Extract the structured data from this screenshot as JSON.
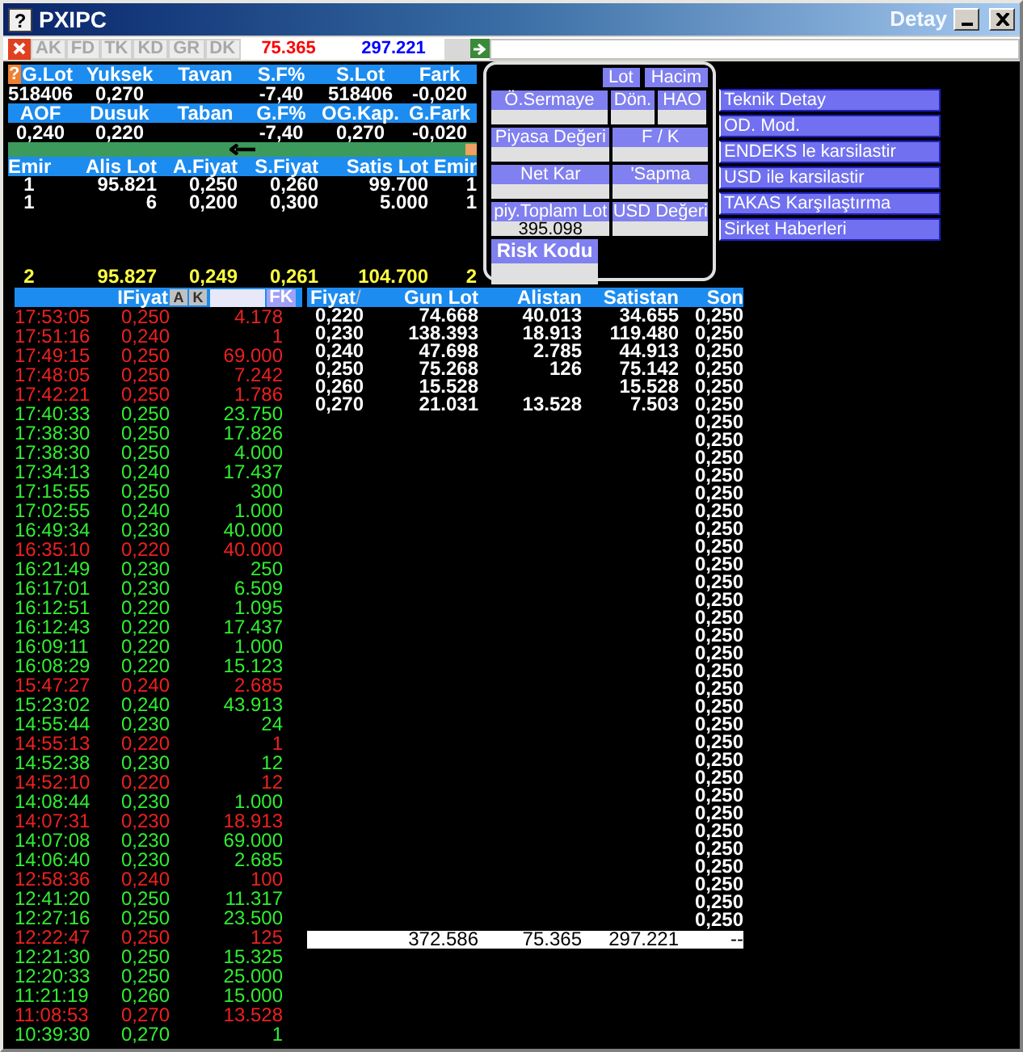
{
  "window": {
    "icon": "?",
    "title": "PXIPC",
    "caption": "Detay"
  },
  "toolbar": {
    "buttons": [
      "AK",
      "FD",
      "TK",
      "KD",
      "GR",
      "DK"
    ],
    "values": [
      {
        "text": "75.365",
        "color": "#ff0000"
      },
      {
        "text": "297.221",
        "color": "#0000ff"
      }
    ]
  },
  "summary": {
    "help": "?",
    "rows": [
      [
        {
          "header": "G.Lot",
          "value": "518406"
        },
        {
          "header": "Yuksek",
          "value": "0,270"
        },
        {
          "header": "Tavan"
        },
        {
          "header": "S.F%",
          "value": "-7,40"
        },
        {
          "header": "S.Lot",
          "value": "518406"
        },
        {
          "header": "Fark",
          "value": "-0,020"
        }
      ],
      [
        {
          "header": "AOF",
          "value": "0,240"
        },
        {
          "header": "Dusuk",
          "value": "0,220"
        },
        {
          "header": "Taban"
        },
        {
          "header": "G.F%",
          "value": "-7,40"
        },
        {
          "header": "OG.Kap.",
          "value": "0,270"
        },
        {
          "header": "G.Fark",
          "value": "-0,020"
        }
      ]
    ]
  },
  "order_book": {
    "columns": [
      "Emir",
      "Alis Lot",
      "A.Fiyat",
      "S.Fiyat",
      "Satis Lot",
      "Emir"
    ],
    "rows": [
      [
        "1",
        "95.821",
        "0,250",
        "0,260",
        "99.700",
        "1"
      ],
      [
        "1",
        "6",
        "0,200",
        "0,300",
        "5.000",
        "1"
      ]
    ],
    "totals": [
      "2",
      "95.827",
      "0,249",
      "0,261",
      "104.700",
      "2"
    ]
  },
  "detail_panel": {
    "buttons": [
      "Lot",
      "Hacim"
    ],
    "rows": [
      [
        {
          "label": "Ö.Sermaye"
        },
        {
          "label": "Dön."
        },
        {
          "label": "HAO"
        }
      ],
      [
        {
          "label": "Piyasa Değeri"
        },
        {
          "label": "F / K"
        }
      ],
      [
        {
          "label": "Net Kar"
        },
        {
          "label": "'Sapma"
        }
      ],
      [
        {
          "label": "piy.Toplam Lot",
          "value": "395.098"
        },
        {
          "label": "USD Değeri"
        }
      ],
      [
        {
          "label": "Risk Kodu"
        }
      ]
    ]
  },
  "menu": [
    "Teknik Detay",
    "OD. Mod.",
    "ENDEKS le karsilastir",
    "USD ile karsilastir",
    "TAKAS Karşılaştırma",
    "Sirket Haberleri"
  ],
  "trades": {
    "header": "IFiyat",
    "filters": [
      "A",
      "K"
    ],
    "fk": "FK",
    "rows": [
      {
        "time": "17:53:05",
        "price": "0,250",
        "lot": "4.178",
        "kind": "down"
      },
      {
        "time": "17:51:16",
        "price": "0,240",
        "lot": "1",
        "kind": "down"
      },
      {
        "time": "17:49:15",
        "price": "0,250",
        "lot": "69.000",
        "kind": "down"
      },
      {
        "time": "17:48:05",
        "price": "0,250",
        "lot": "7.242",
        "kind": "down"
      },
      {
        "time": "17:42:21",
        "price": "0,250",
        "lot": "1.786",
        "kind": "down"
      },
      {
        "time": "17:40:33",
        "price": "0,250",
        "lot": "23.750",
        "kind": "up"
      },
      {
        "time": "17:38:30",
        "price": "0,250",
        "lot": "17.826",
        "kind": "up"
      },
      {
        "time": "17:38:30",
        "price": "0,250",
        "lot": "4.000",
        "kind": "up"
      },
      {
        "time": "17:34:13",
        "price": "0,240",
        "lot": "17.437",
        "kind": "up"
      },
      {
        "time": "17:15:55",
        "price": "0,250",
        "lot": "300",
        "kind": "up"
      },
      {
        "time": "17:02:55",
        "price": "0,240",
        "lot": "1.000",
        "kind": "up"
      },
      {
        "time": "16:49:34",
        "price": "0,230",
        "lot": "40.000",
        "kind": "up"
      },
      {
        "time": "16:35:10",
        "price": "0,220",
        "lot": "40.000",
        "kind": "down"
      },
      {
        "time": "16:21:49",
        "price": "0,230",
        "lot": "250",
        "kind": "up"
      },
      {
        "time": "16:17:01",
        "price": "0,230",
        "lot": "6.509",
        "kind": "up"
      },
      {
        "time": "16:12:51",
        "price": "0,220",
        "lot": "1.095",
        "kind": "up"
      },
      {
        "time": "16:12:43",
        "price": "0,220",
        "lot": "17.437",
        "kind": "up"
      },
      {
        "time": "16:09:11",
        "price": "0,220",
        "lot": "1.000",
        "kind": "up"
      },
      {
        "time": "16:08:29",
        "price": "0,220",
        "lot": "15.123",
        "kind": "up"
      },
      {
        "time": "15:47:27",
        "price": "0,240",
        "lot": "2.685",
        "kind": "down"
      },
      {
        "time": "15:23:02",
        "price": "0,240",
        "lot": "43.913",
        "kind": "up"
      },
      {
        "time": "14:55:44",
        "price": "0,230",
        "lot": "24",
        "kind": "up"
      },
      {
        "time": "14:55:13",
        "price": "0,220",
        "lot": "1",
        "kind": "down"
      },
      {
        "time": "14:52:38",
        "price": "0,230",
        "lot": "12",
        "kind": "up"
      },
      {
        "time": "14:52:10",
        "price": "0,220",
        "lot": "12",
        "kind": "down"
      },
      {
        "time": "14:08:44",
        "price": "0,230",
        "lot": "1.000",
        "kind": "up"
      },
      {
        "time": "14:07:31",
        "price": "0,230",
        "lot": "18.913",
        "kind": "down"
      },
      {
        "time": "14:07:08",
        "price": "0,230",
        "lot": "69.000",
        "kind": "up"
      },
      {
        "time": "14:06:40",
        "price": "0,230",
        "lot": "2.685",
        "kind": "up"
      },
      {
        "time": "12:58:36",
        "price": "0,240",
        "lot": "100",
        "kind": "down"
      },
      {
        "time": "12:41:20",
        "price": "0,250",
        "lot": "11.317",
        "kind": "up"
      },
      {
        "time": "12:27:16",
        "price": "0,250",
        "lot": "23.500",
        "kind": "up"
      },
      {
        "time": "12:22:47",
        "price": "0,250",
        "lot": "125",
        "kind": "down"
      },
      {
        "time": "12:21:30",
        "price": "0,250",
        "lot": "15.325",
        "kind": "up"
      },
      {
        "time": "12:20:33",
        "price": "0,250",
        "lot": "25.000",
        "kind": "up"
      },
      {
        "time": "11:21:19",
        "price": "0,260",
        "lot": "15.000",
        "kind": "up"
      },
      {
        "time": "11:08:53",
        "price": "0,270",
        "lot": "13.528",
        "kind": "down"
      },
      {
        "time": "10:39:30",
        "price": "0,270",
        "lot": "1",
        "kind": "up"
      }
    ]
  },
  "price_table": {
    "columns": [
      "Fiyat",
      "Gun Lot",
      "Alistan",
      "Satistan",
      "Son"
    ],
    "sort_mark": "/",
    "rows": [
      {
        "fiyat": "0,220",
        "gun_lot": "74.668",
        "alistan": "40.013",
        "satistan": "34.655",
        "son": "0,250"
      },
      {
        "fiyat": "0,230",
        "gun_lot": "138.393",
        "alistan": "18.913",
        "satistan": "119.480",
        "son": "0,250"
      },
      {
        "fiyat": "0,240",
        "gun_lot": "47.698",
        "alistan": "2.785",
        "satistan": "44.913",
        "son": "0,250"
      },
      {
        "fiyat": "0,250",
        "gun_lot": "75.268",
        "alistan": "126",
        "satistan": "75.142",
        "son": "0,250"
      },
      {
        "fiyat": "0,260",
        "gun_lot": "15.528",
        "satistan": "15.528",
        "son": "0,250"
      },
      {
        "fiyat": "0,270",
        "gun_lot": "21.031",
        "alistan": "13.528",
        "satistan": "7.503",
        "son": "0,250"
      },
      {
        "son": "0,250"
      },
      {
        "son": "0,250"
      },
      {
        "son": "0,250"
      },
      {
        "son": "0,250"
      },
      {
        "son": "0,250"
      },
      {
        "son": "0,250"
      },
      {
        "son": "0,250"
      },
      {
        "son": "0,250"
      },
      {
        "son": "0,250"
      },
      {
        "son": "0,250"
      },
      {
        "son": "0,250"
      },
      {
        "son": "0,250"
      },
      {
        "son": "0,250"
      },
      {
        "son": "0,250"
      },
      {
        "son": "0,250"
      },
      {
        "son": "0,250"
      },
      {
        "son": "0,250"
      },
      {
        "son": "0,250"
      },
      {
        "son": "0,250"
      },
      {
        "son": "0,250"
      },
      {
        "son": "0,250"
      },
      {
        "son": "0,250"
      },
      {
        "son": "0,250"
      },
      {
        "son": "0,250"
      },
      {
        "son": "0,250"
      },
      {
        "son": "0,250"
      },
      {
        "son": "0,250"
      },
      {
        "son": "0,250"
      },
      {
        "son": "0,250"
      }
    ],
    "totals": {
      "gun_lot": "372.586",
      "alistan": "75.365",
      "satistan": "297.221",
      "son": "--"
    }
  }
}
